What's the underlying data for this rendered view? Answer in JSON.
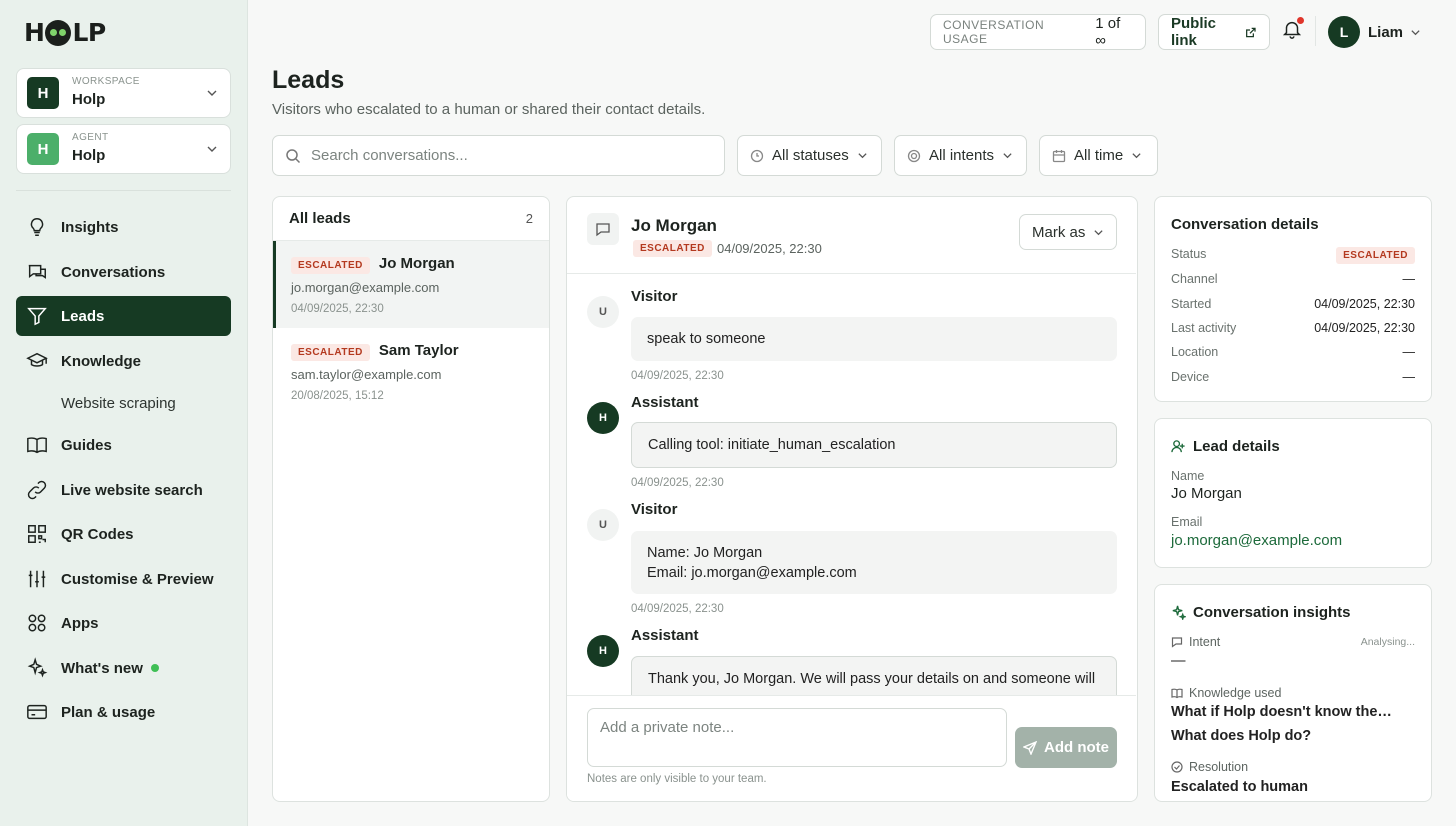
{
  "app": {
    "logo": "HOLP"
  },
  "sidebar": {
    "workspace": {
      "caption": "WORKSPACE",
      "initial": "H",
      "value": "Holp"
    },
    "agent": {
      "caption": "AGENT",
      "initial": "H",
      "value": "Holp"
    },
    "nav": [
      {
        "label": "Insights",
        "icon": "lightbulb-icon"
      },
      {
        "label": "Conversations",
        "icon": "chat-bubbles-icon"
      },
      {
        "label": "Leads",
        "icon": "funnel-icon",
        "active": true
      },
      {
        "label": "Knowledge",
        "icon": "graduation-cap-icon"
      },
      {
        "label": "Website scraping",
        "sub": true
      },
      {
        "label": "Guides",
        "icon": "book-icon"
      },
      {
        "label": "Live website search",
        "icon": "link-icon"
      },
      {
        "label": "QR Codes",
        "icon": "qr-code-icon"
      },
      {
        "label": "Customise & Preview",
        "icon": "sliders-icon"
      },
      {
        "label": "Apps",
        "icon": "apps-grid-icon"
      },
      {
        "label": "What's new",
        "icon": "sparkles-icon"
      },
      {
        "label": "Plan & usage",
        "icon": "credit-card-icon"
      }
    ]
  },
  "topbar": {
    "usage_label": "CONVERSATION USAGE",
    "usage_value": "1 of ∞",
    "public_link": "Public link",
    "user_initial": "L",
    "user_name": "Liam"
  },
  "page": {
    "title": "Leads",
    "subtitle": "Visitors who escalated to a human or shared their contact details.",
    "search_placeholder": "Search conversations...",
    "filters": {
      "status": "All statuses",
      "intent": "All intents",
      "time": "All time"
    }
  },
  "leads": {
    "header": "All leads",
    "count": "2",
    "items": [
      {
        "badge": "ESCALATED",
        "name": "Jo Morgan",
        "email": "jo.morgan@example.com",
        "date": "04/09/2025, 22:30"
      },
      {
        "badge": "ESCALATED",
        "name": "Sam Taylor",
        "email": "sam.taylor@example.com",
        "date": "20/08/2025, 15:12"
      }
    ]
  },
  "conversation": {
    "name": "Jo Morgan",
    "badge": "ESCALATED",
    "time": "04/09/2025, 22:30",
    "mark_as": "Mark as",
    "messages": [
      {
        "role": "Visitor",
        "avatar": "U",
        "text": "speak to someone",
        "time": "04/09/2025, 22:30"
      },
      {
        "role": "Assistant",
        "avatar": "H",
        "text": "Calling tool: initiate_human_escalation",
        "time": "04/09/2025, 22:30"
      },
      {
        "role": "Visitor",
        "avatar": "U",
        "line1": "Name: Jo Morgan",
        "line2": "Email: jo.morgan@example.com",
        "time": "04/09/2025, 22:30"
      },
      {
        "role": "Assistant",
        "avatar": "H",
        "text": "Thank you, Jo Morgan. We will pass your details on and someone will"
      }
    ],
    "note_placeholder": "Add a private note...",
    "add_note": "Add note",
    "note_hint": "Notes are only visible to your team."
  },
  "details": {
    "title": "Conversation details",
    "rows": [
      {
        "k": "Status",
        "v": "ESCALATED"
      },
      {
        "k": "Channel",
        "v": "—"
      },
      {
        "k": "Started",
        "v": "04/09/2025, 22:30"
      },
      {
        "k": "Last activity",
        "v": "04/09/2025, 22:30"
      },
      {
        "k": "Location",
        "v": "—"
      },
      {
        "k": "Device",
        "v": "—"
      }
    ]
  },
  "lead_details": {
    "title": "Lead details",
    "name_label": "Name",
    "name": "Jo Morgan",
    "email_label": "Email",
    "email": "jo.morgan@example.com"
  },
  "insights": {
    "title": "Conversation insights",
    "intent_label": "Intent",
    "intent_status": "Analysing...",
    "intent_value": "—",
    "knowledge_label": "Knowledge used",
    "knowledge": [
      "What if Holp doesn't know the…",
      "What does Holp do?"
    ],
    "resolution_label": "Resolution",
    "resolution": "Escalated to human"
  },
  "colors": {
    "brand": "#163a23",
    "badge_bg": "#fbe8e4",
    "badge_fg": "#b4391f",
    "link": "#1d6a3b",
    "notify": "#e0352b"
  }
}
